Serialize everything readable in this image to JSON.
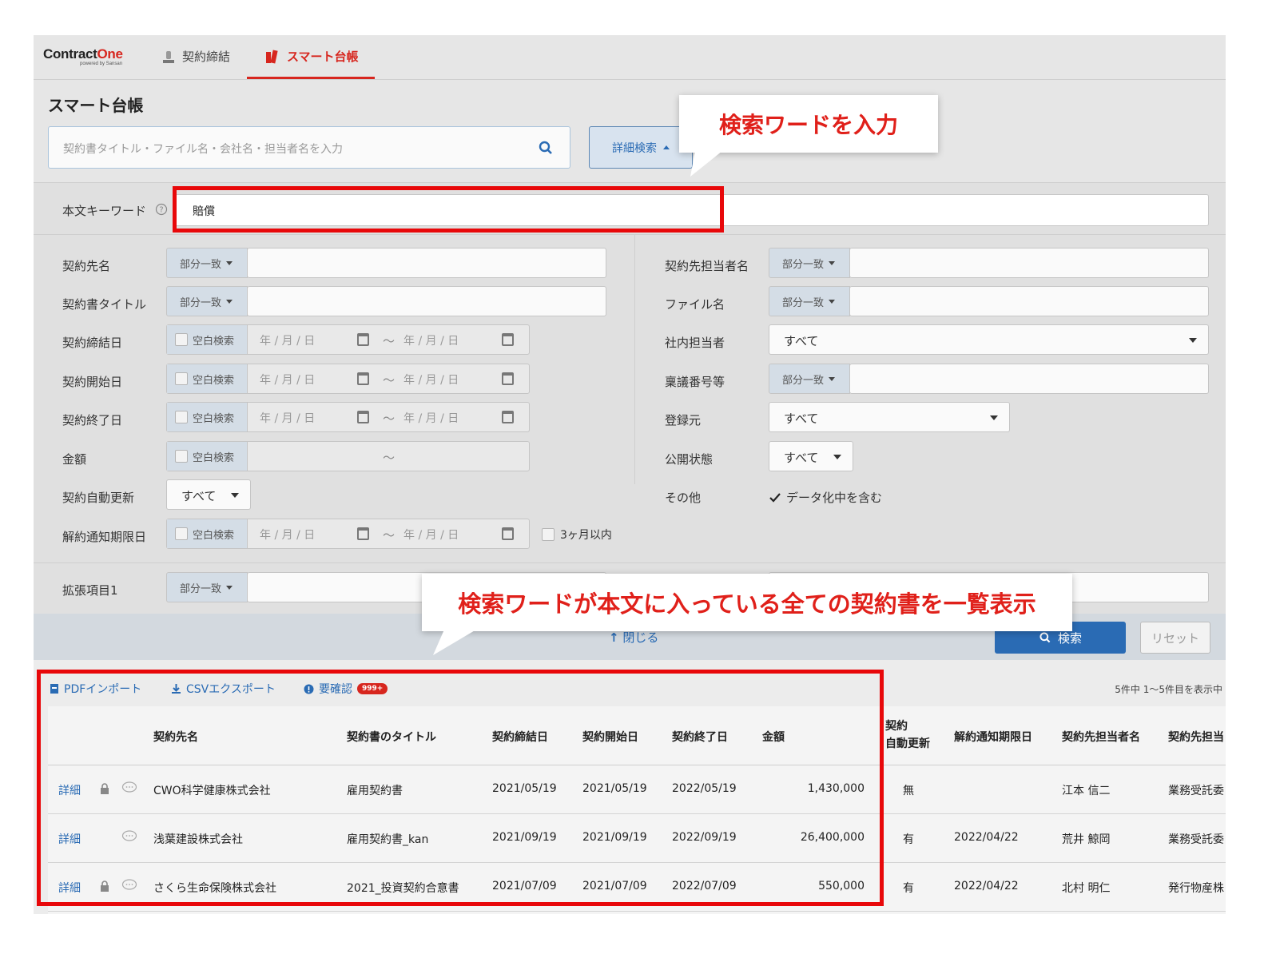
{
  "nav": {
    "logo_main": "Contract",
    "logo_accent": "One",
    "logo_sub": "powered by Sansan",
    "items": [
      {
        "label": "契約締結",
        "icon": "stamp-icon",
        "active": false
      },
      {
        "label": "スマート台帳",
        "icon": "ledger-icon",
        "active": true
      }
    ],
    "accent_color": "#d7261e"
  },
  "page_title": "スマート台帳",
  "search": {
    "placeholder": "契約書タイトル・ファイル名・会社名・担当者名を入力",
    "advanced_label": "詳細検索"
  },
  "keyword": {
    "label": "本文キーワード",
    "value": "賠償"
  },
  "left_fields": {
    "partner_name": {
      "label": "契約先名",
      "match": "部分一致"
    },
    "title": {
      "label": "契約書タイトル",
      "match": "部分一致"
    },
    "signed_date": {
      "label": "契約締結日"
    },
    "start_date": {
      "label": "契約開始日"
    },
    "end_date": {
      "label": "契約終了日"
    },
    "amount": {
      "label": "金額"
    },
    "auto_renew": {
      "label": "契約自動更新",
      "value": "すべて"
    },
    "notice_date": {
      "label": "解約通知期限日",
      "within": "3ヶ月以内"
    },
    "ext1": {
      "label": "拡張項目1",
      "match": "部分一致"
    }
  },
  "right_fields": {
    "partner_person": {
      "label": "契約先担当者名",
      "match": "部分一致"
    },
    "file_name": {
      "label": "ファイル名",
      "match": "部分一致"
    },
    "internal_person": {
      "label": "社内担当者",
      "value": "すべて"
    },
    "proposal_no": {
      "label": "稟議番号等",
      "match": "部分一致"
    },
    "source": {
      "label": "登録元",
      "value": "すべて"
    },
    "visibility": {
      "label": "公開状態",
      "value": "すべて"
    },
    "other": {
      "label": "その他",
      "checkbox_label": "データ化中を含む"
    }
  },
  "date_placeholder": "年 / 月 / 日",
  "blank_search": "空白検索",
  "tilde": "～",
  "actions": {
    "close": "閉じる",
    "search": "検索",
    "reset": "リセット"
  },
  "toolbar": {
    "pdf_import": "PDFインポート",
    "csv_export": "CSVエクスポート",
    "needs_check": "要確認",
    "needs_check_badge": "999+",
    "count_text": "5件中 1〜5件目を表示中"
  },
  "table": {
    "headers": [
      "契約先名",
      "契約書のタイトル",
      "契約締結日",
      "契約開始日",
      "契約終了日",
      "金額",
      "契約\n自動更新",
      "解約通知期限日",
      "契約先担当者名",
      "契約先担当"
    ],
    "header_renew_1": "契約",
    "header_renew_2": "自動更新",
    "detail_label": "詳細",
    "rows": [
      {
        "partner": "CWO科学健康株式会社",
        "title": "雇用契約書",
        "signed": "2021/05/19",
        "start": "2021/05/19",
        "end": "2022/05/19",
        "amount": "1,430,000",
        "renew": "無",
        "notice": "",
        "person": "江本 信二",
        "dept": "業務受託委",
        "locked": true
      },
      {
        "partner": "浅葉建設株式会社",
        "title": "雇用契約書_kan",
        "signed": "2021/09/19",
        "start": "2021/09/19",
        "end": "2022/09/19",
        "amount": "26,400,000",
        "renew": "有",
        "notice": "2022/04/22",
        "person": "荒井 鯨岡",
        "dept": "業務受託委",
        "locked": false
      },
      {
        "partner": "さくら生命保険株式会社",
        "title": "2021_投資契約合意書",
        "signed": "2021/07/09",
        "start": "2021/07/09",
        "end": "2022/07/09",
        "amount": "550,000",
        "renew": "有",
        "notice": "2022/04/22",
        "person": "北村 明仁",
        "dept": "発行物産株",
        "locked": true
      }
    ]
  },
  "annotations": {
    "callout_top": "検索ワードを入力",
    "callout_bottom": "検索ワードが本文に入っている全ての契約書を一覧表示",
    "highlight_color": "#e8080a"
  }
}
